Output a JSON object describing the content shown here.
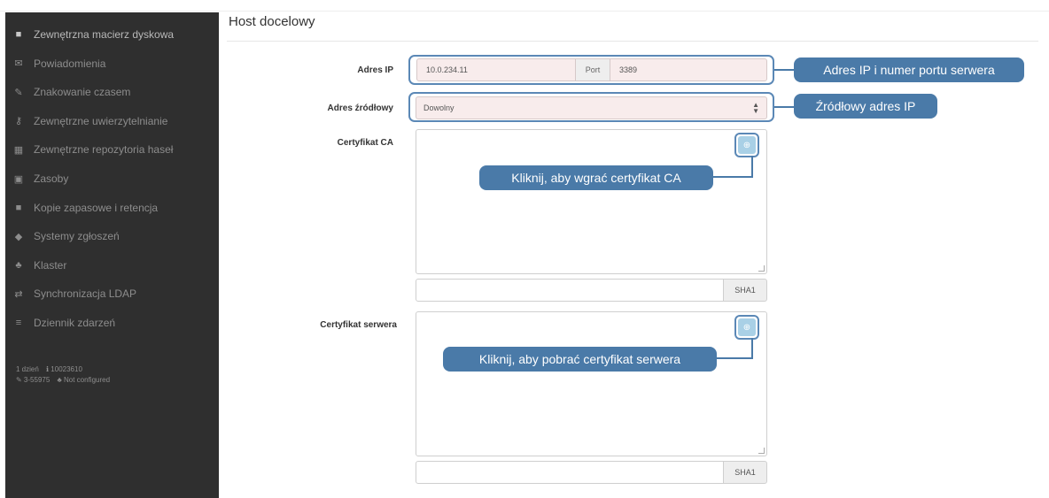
{
  "sidebar": {
    "items": [
      {
        "icon": "folder-icon",
        "glyph": "■",
        "label": "Zewnętrzna macierz dyskowa",
        "active": true
      },
      {
        "icon": "envelope-icon",
        "glyph": "✉",
        "label": "Powiadomienia",
        "active": false
      },
      {
        "icon": "pencil-icon",
        "glyph": "✎",
        "label": "Znakowanie czasem",
        "active": false
      },
      {
        "icon": "key-icon",
        "glyph": "⚷",
        "label": "Zewnętrzne uwierzytelnianie",
        "active": false
      },
      {
        "icon": "grid-icon",
        "glyph": "▦",
        "label": "Zewnętrzne repozytoria haseł",
        "active": false
      },
      {
        "icon": "image-icon",
        "glyph": "▣",
        "label": "Zasoby",
        "active": false
      },
      {
        "icon": "save-icon",
        "glyph": "■",
        "label": "Kopie zapasowe i retencja",
        "active": false
      },
      {
        "icon": "tag-icon",
        "glyph": "◆",
        "label": "Systemy zgłoszeń",
        "active": false
      },
      {
        "icon": "sitemap-icon",
        "glyph": "♣",
        "label": "Klaster",
        "active": false
      },
      {
        "icon": "exchange-icon",
        "glyph": "⇄",
        "label": "Synchronizacja LDAP",
        "active": false
      },
      {
        "icon": "list-icon",
        "glyph": "≡",
        "label": "Dziennik zdarzeń",
        "active": false
      }
    ],
    "info": {
      "uptime": "1 dzień",
      "license": "ℹ 10023610",
      "version": "✎ 3-55975",
      "cluster": "♣ Not configured"
    }
  },
  "main": {
    "title": "Host docelowy",
    "ip_label": "Adres IP",
    "ip_value": "10.0.234.11",
    "port_label": "Port",
    "port_value": "3389",
    "source_label": "Adres źródłowy",
    "source_value": "Dowolny",
    "ca_label": "Certyfikat CA",
    "server_cert_label": "Certyfikat serwera",
    "sha1_label": "SHA1",
    "sha1_label_2": "SHA1"
  },
  "callouts": {
    "ip_port": "Adres IP i numer portu serwera",
    "source_ip": "Źródłowy adres IP",
    "ca_upload": "Kliknij, aby wgrać certyfikat CA",
    "server_download": "Kliknij, aby pobrać certyfikat serwera"
  },
  "colors": {
    "callout": "#4a7aa8",
    "sidebar_bg": "#2f2f2f",
    "field_bg": "#f8ecec"
  }
}
